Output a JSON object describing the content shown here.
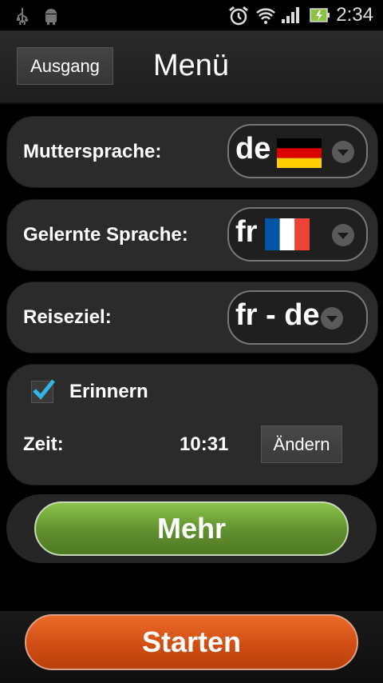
{
  "status_bar": {
    "time": "2:34",
    "icons": [
      "usb-icon",
      "android-debug-icon",
      "alarm-icon",
      "wifi-icon",
      "signal-icon",
      "battery-charging-icon"
    ]
  },
  "header": {
    "exit_label": "Ausgang",
    "title": "Menü"
  },
  "native_language": {
    "label": "Muttersprache:",
    "value": "de",
    "flag": "germany-flag"
  },
  "learned_language": {
    "label": "Gelernte Sprache:",
    "value": "fr",
    "flag": "france-flag"
  },
  "destination": {
    "label": "Reiseziel:",
    "value": "fr - de"
  },
  "reminder": {
    "checkbox_label": "Erinnern",
    "checked": true,
    "time_label": "Zeit:",
    "time_value": "10:31",
    "change_label": "Ändern"
  },
  "more_button": "Mehr",
  "start_button": "Starten",
  "colors": {
    "more_green": "#6ea238",
    "start_orange": "#d9531a",
    "check_blue": "#33b5e5"
  }
}
